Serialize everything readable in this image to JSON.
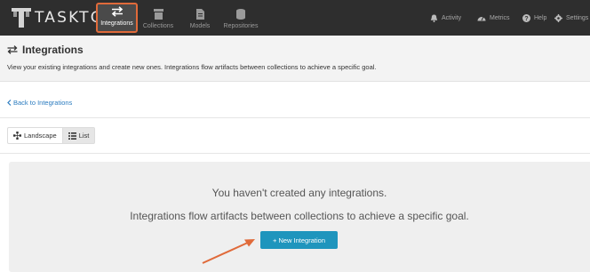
{
  "brand": {
    "name": "TASKTOP",
    "accent": "#e06a3a",
    "button_color": "#1f95bd",
    "link_color": "#2a7bbf"
  },
  "nav": {
    "tabs": [
      {
        "label": "Integrations",
        "icon": "swap-arrows-icon",
        "active": true
      },
      {
        "label": "Collections",
        "icon": "archive-box-icon",
        "active": false
      },
      {
        "label": "Models",
        "icon": "document-icon",
        "active": false
      },
      {
        "label": "Repositories",
        "icon": "database-icon",
        "active": false
      }
    ],
    "right": [
      {
        "label": "Activity",
        "icon": "bell-icon"
      },
      {
        "label": "Metrics",
        "icon": "gauge-icon"
      },
      {
        "label": "Help",
        "icon": "question-circle-icon"
      },
      {
        "label": "Settings",
        "icon": "gear-icon"
      }
    ]
  },
  "header": {
    "title": "Integrations",
    "description": "View your existing integrations and create new ones. Integrations flow artifacts between collections to achieve a specific goal."
  },
  "back_link": "Back to Integrations",
  "view_toggle": {
    "landscape": "Landscape",
    "list": "List"
  },
  "empty_state": {
    "line1": "You haven't created any integrations.",
    "line2": "Integrations flow artifacts between collections to achieve a specific goal.",
    "button": "+ New Integration"
  }
}
